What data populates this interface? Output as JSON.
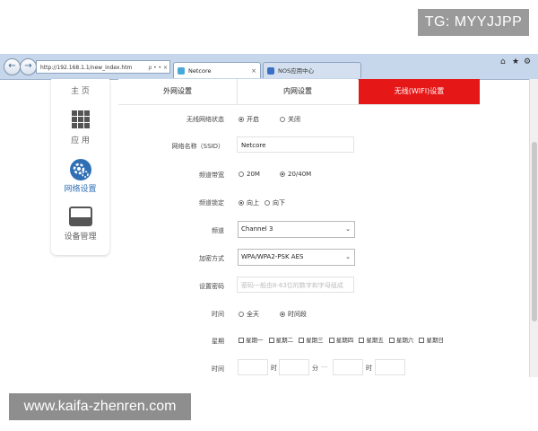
{
  "watermark_top": "TG: MYYJJPP",
  "watermark_bottom": "www.kaifa-zhenren.com",
  "browser": {
    "url": "http://192.168.1.1/new_index.htm",
    "url_controls": "ρ • • ×",
    "tabs": [
      {
        "label": "Netcore",
        "active": true
      },
      {
        "label": "NOS应用中心",
        "active": false
      }
    ],
    "tab_icon_colors": [
      "#4aa8d8",
      "#3b6fc4"
    ]
  },
  "sidebar": {
    "items": [
      {
        "label": "主 页",
        "icon": "home-icon",
        "selected": false
      },
      {
        "label": "应 用",
        "icon": "apps-grid-icon",
        "selected": false
      },
      {
        "label": "网络设置",
        "icon": "network-settings-icon",
        "selected": true
      },
      {
        "label": "设备管理",
        "icon": "device-management-icon",
        "selected": false
      }
    ],
    "selected_color": "#2f6fb5"
  },
  "top_tabs": [
    {
      "label": "外网设置",
      "active": false
    },
    {
      "label": "内网设置",
      "active": false
    },
    {
      "label": "无线(WIFI)设置",
      "active": true
    }
  ],
  "accent_color": "#e51717",
  "form": {
    "wifi_status": {
      "label": "无线网络状态",
      "options": [
        "开启",
        "关闭"
      ],
      "selected": "开启"
    },
    "ssid": {
      "label": "网络名称（SSID）",
      "value": "Netcore"
    },
    "bandwidth": {
      "label": "频道带宽",
      "options": [
        "20M",
        "20/40M"
      ],
      "selected": "20/40M"
    },
    "channel_lock": {
      "label": "频道锁定",
      "options": [
        "向上",
        "向下"
      ],
      "selected": "向上"
    },
    "channel": {
      "label": "频道",
      "value": "Channel 3"
    },
    "encryption": {
      "label": "加密方式",
      "value": "WPA/WPA2-PSK AES"
    },
    "password": {
      "label": "设置密码",
      "placeholder": "密码一般由8-63位的数字和字母组成"
    },
    "schedule": {
      "label": "时间",
      "options": [
        "全天",
        "时间段"
      ],
      "selected": "时间段"
    },
    "weekdays": {
      "label": "星期",
      "days": [
        "星期一",
        "星期二",
        "星期三",
        "星期四",
        "星期五",
        "星期六",
        "星期日"
      ]
    },
    "time_range": {
      "label": "时间",
      "hour_unit": "时",
      "minute_unit": "分",
      "separator": "---",
      "hour_unit_2": "时"
    }
  }
}
